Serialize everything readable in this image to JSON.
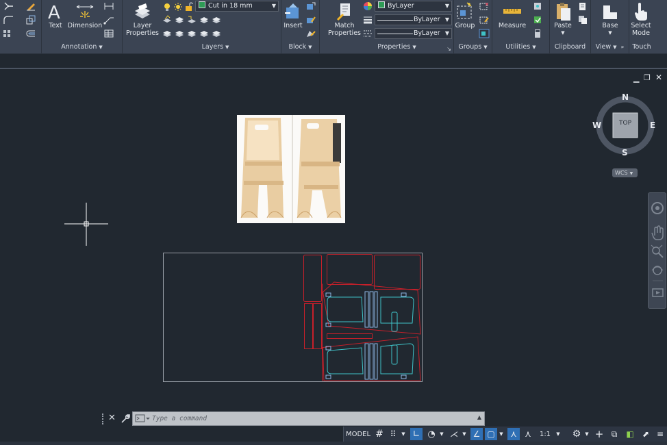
{
  "ribbon": {
    "annotation": {
      "title": "Annotation",
      "text_label": "Text",
      "dimension_label": "Dimension"
    },
    "layers": {
      "title": "Layers",
      "layer_properties_label": "Layer Properties",
      "current_layer": "Cut in 18 mm",
      "layer_color": "#2e9b56"
    },
    "block": {
      "title": "Block",
      "insert_label": "Insert"
    },
    "properties": {
      "title": "Properties",
      "match_properties_label": "Match Properties",
      "color": "ByLayer",
      "linetype": "ByLayer",
      "lineweight": "ByLayer",
      "color_swatch": "#2e9b56"
    },
    "groups": {
      "title": "Groups",
      "group_label": "Group"
    },
    "utilities": {
      "title": "Utilities",
      "measure_label": "Measure"
    },
    "clipboard": {
      "title": "Clipboard",
      "paste_label": "Paste"
    },
    "view": {
      "title": "View",
      "base_label": "Base"
    },
    "touch": {
      "title": "Touch",
      "select_mode_label": "Select Mode"
    }
  },
  "viewcube": {
    "top": "TOP",
    "north": "N",
    "south": "S",
    "east": "E",
    "west": "W",
    "wcs": "WCS"
  },
  "command": {
    "placeholder": "Type a command"
  },
  "status": {
    "model": "MODEL",
    "scale": "1:1"
  },
  "colors": {
    "accent": "#2f6fb4",
    "background": "#212830",
    "ribbon": "#3b4453",
    "cut_red": "#c8202a",
    "cut_cyan": "#3fc2c7",
    "frame_gray": "#9aa0a8"
  }
}
